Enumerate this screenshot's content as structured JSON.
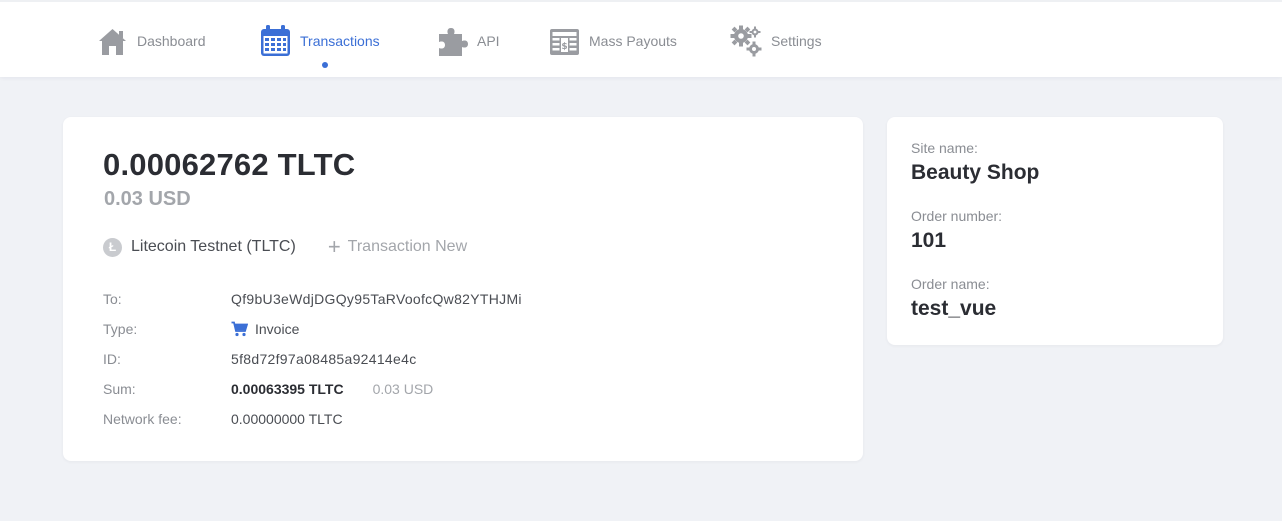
{
  "nav": {
    "items": [
      {
        "label": "Dashboard",
        "icon": "home-icon",
        "active": false
      },
      {
        "label": "Transactions",
        "icon": "calendar-icon",
        "active": true
      },
      {
        "label": "API",
        "icon": "puzzle-icon",
        "active": false
      },
      {
        "label": "Mass Payouts",
        "icon": "cash-register-icon",
        "active": false
      },
      {
        "label": "Settings",
        "icon": "gears-icon",
        "active": false
      }
    ]
  },
  "transaction": {
    "amount_crypto": "0.00062762 TLTC",
    "amount_fiat": "0.03 USD",
    "currency_name": "Litecoin Testnet (TLTC)",
    "currency_icon_glyph": "Ł",
    "new_link_label": "Transaction New",
    "details": {
      "to_label": "To:",
      "to_value": "Qf9bU3eWdjDGQy95TaRVoofcQw82YTHJMi",
      "type_label": "Type:",
      "type_value": "Invoice",
      "id_label": "ID:",
      "id_value": "5f8d72f97a08485a92414e4c",
      "sum_label": "Sum:",
      "sum_crypto": "0.00063395 TLTC",
      "sum_fiat": "0.03 USD",
      "fee_label": "Network fee:",
      "fee_value": "0.00000000 TLTC"
    }
  },
  "order": {
    "site_label": "Site name:",
    "site_value": "Beauty Shop",
    "number_label": "Order number:",
    "number_value": "101",
    "name_label": "Order name:",
    "name_value": "test_vue"
  },
  "colors": {
    "accent": "#3b6fd6",
    "muted_text": "#8a8d93",
    "background": "#f0f2f6"
  }
}
